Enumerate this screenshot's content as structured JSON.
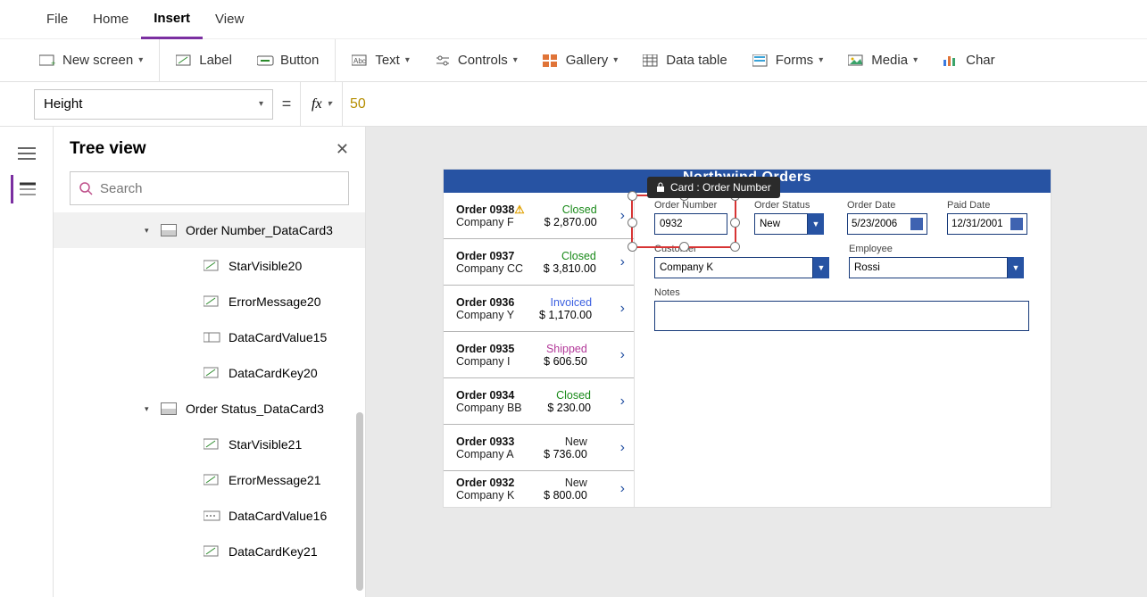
{
  "menu": {
    "file": "File",
    "home": "Home",
    "insert": "Insert",
    "view": "View"
  },
  "ribbon": {
    "newscreen": "New screen",
    "label": "Label",
    "button": "Button",
    "text": "Text",
    "controls": "Controls",
    "gallery": "Gallery",
    "datatable": "Data table",
    "forms": "Forms",
    "media": "Media",
    "chart": "Char"
  },
  "formula": {
    "property": "Height",
    "eq": "=",
    "fx": "fx",
    "value": "50"
  },
  "treeview": {
    "title": "Tree view",
    "search_placeholder": "Search",
    "items": [
      {
        "label": "Order Number_DataCard3",
        "type": "card",
        "selected": true
      },
      {
        "label": "StarVisible20",
        "type": "child",
        "icon": "pencil"
      },
      {
        "label": "ErrorMessage20",
        "type": "child",
        "icon": "pencil"
      },
      {
        "label": "DataCardValue15",
        "type": "child",
        "icon": "field"
      },
      {
        "label": "DataCardKey20",
        "type": "child",
        "icon": "pencil"
      },
      {
        "label": "Order Status_DataCard3",
        "type": "card"
      },
      {
        "label": "StarVisible21",
        "type": "child",
        "icon": "pencil"
      },
      {
        "label": "ErrorMessage21",
        "type": "child",
        "icon": "pencil"
      },
      {
        "label": "DataCardValue16",
        "type": "child",
        "icon": "value"
      },
      {
        "label": "DataCardKey21",
        "type": "child",
        "icon": "pencil"
      }
    ]
  },
  "app": {
    "header": "Northwind Orders",
    "orders": [
      {
        "id": "Order 0938",
        "warn": true,
        "company": "Company F",
        "amount": "$ 2,870.00",
        "status": "Closed",
        "statusClass": "closed"
      },
      {
        "id": "Order 0937",
        "company": "Company CC",
        "amount": "$ 3,810.00",
        "status": "Closed",
        "statusClass": "closed"
      },
      {
        "id": "Order 0936",
        "company": "Company Y",
        "amount": "$ 1,170.00",
        "status": "Invoiced",
        "statusClass": "invoiced"
      },
      {
        "id": "Order 0935",
        "company": "Company I",
        "amount": "$ 606.50",
        "status": "Shipped",
        "statusClass": "shipped"
      },
      {
        "id": "Order 0934",
        "company": "Company BB",
        "amount": "$ 230.00",
        "status": "Closed",
        "statusClass": "closed"
      },
      {
        "id": "Order 0933",
        "company": "Company A",
        "amount": "$ 736.00",
        "status": "New",
        "statusClass": "new"
      },
      {
        "id": "Order 0932",
        "company": "Company K",
        "amount": "$ 800.00",
        "status": "New",
        "statusClass": "new"
      }
    ],
    "form": {
      "orderNumber_label": "Order Number",
      "orderNumber": "0932",
      "orderStatus_label": "Order Status",
      "orderStatus": "New",
      "orderDate_label": "Order Date",
      "orderDate": "5/23/2006",
      "paidDate_label": "Paid Date",
      "paidDate": "12/31/2001",
      "customer_label": "Customer",
      "customer": "Company K",
      "employee_label": "Employee",
      "employee": "Rossi",
      "notes_label": "Notes"
    },
    "selection_tag": "Card : Order Number"
  }
}
